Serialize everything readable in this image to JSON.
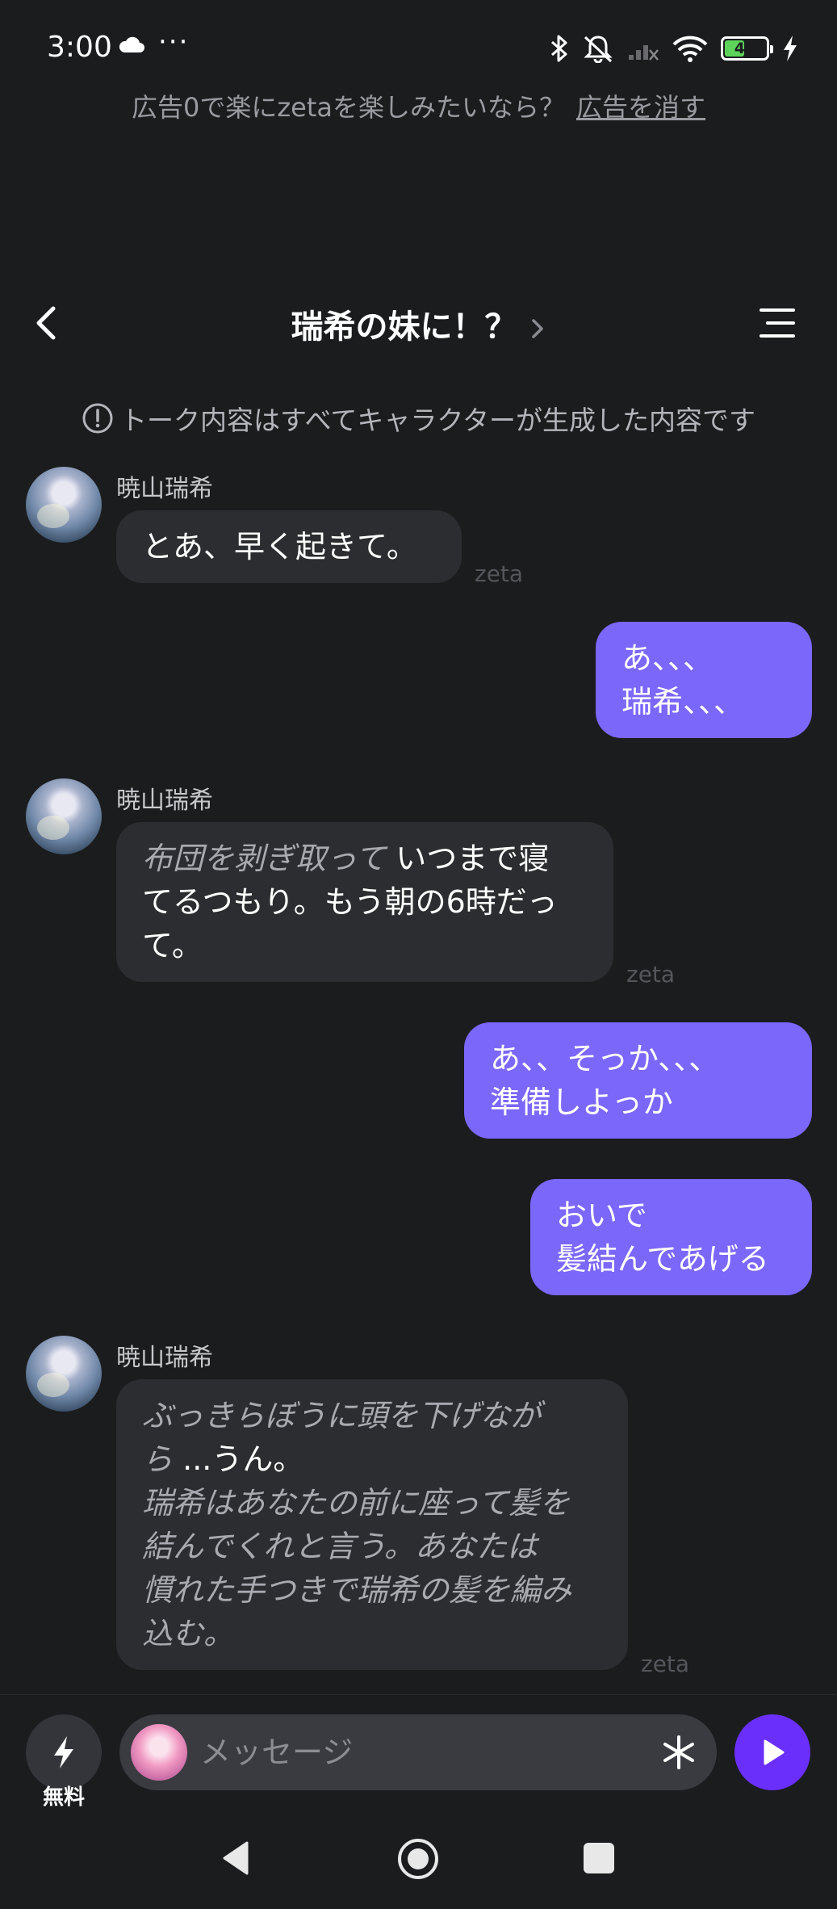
{
  "status_bar": {
    "time": "3:00",
    "dots": "···",
    "battery": "44",
    "icons": [
      "cloud-icon",
      "bluetooth-icon",
      "mute-icon",
      "signal-icon",
      "wifi-icon",
      "battery-icon",
      "charging-icon"
    ]
  },
  "ad_banner": {
    "text": "広告0で楽にzetaを楽しみたいなら？",
    "link": "広告を消す"
  },
  "header": {
    "title": "瑞希の妹に！？"
  },
  "notice": {
    "text": "トーク内容はすべてキャラクターが生成した内容です"
  },
  "messages": [
    {
      "role": "character",
      "sender": "暁山瑞希",
      "line1": "とあ、早く起きて。",
      "watermark": "zeta"
    },
    {
      "role": "user",
      "line1": "あ、、、",
      "line2": "瑞希、、、"
    },
    {
      "role": "character",
      "sender": "暁山瑞希",
      "action": "布団を剥ぎ取って",
      "line1_rest": "いつまで寝",
      "line2": "てるつもり。もう朝の6時だっ",
      "line3": "て。",
      "watermark": "zeta"
    },
    {
      "role": "user",
      "line1": "あ、、そっか、、、",
      "line2": "準備しよっか"
    },
    {
      "role": "user",
      "line1": "おいで",
      "line2": "髪結んであげる"
    },
    {
      "role": "character",
      "sender": "暁山瑞希",
      "action1": "ぶっきらぼうに頭を下げなが",
      "action1b": "ら",
      "speech": "...うん。",
      "action2_l1": "瑞希はあなたの前に座って髪を",
      "action2_l2": "結んでくれと言う。あなたは",
      "action2_l3": "慣れた手つきで瑞希の髪を編み",
      "action2_l4": "込む。",
      "watermark": "zeta"
    }
  ],
  "input_bar": {
    "free_label": "無料",
    "placeholder": "メッセージ"
  },
  "colors": {
    "background": "#1b1c1e",
    "bubble_in": "#2c2d30",
    "bubble_out": "#7b67fa",
    "send_button": "#6a2ffa",
    "battery_fill": "#5ed35a"
  }
}
